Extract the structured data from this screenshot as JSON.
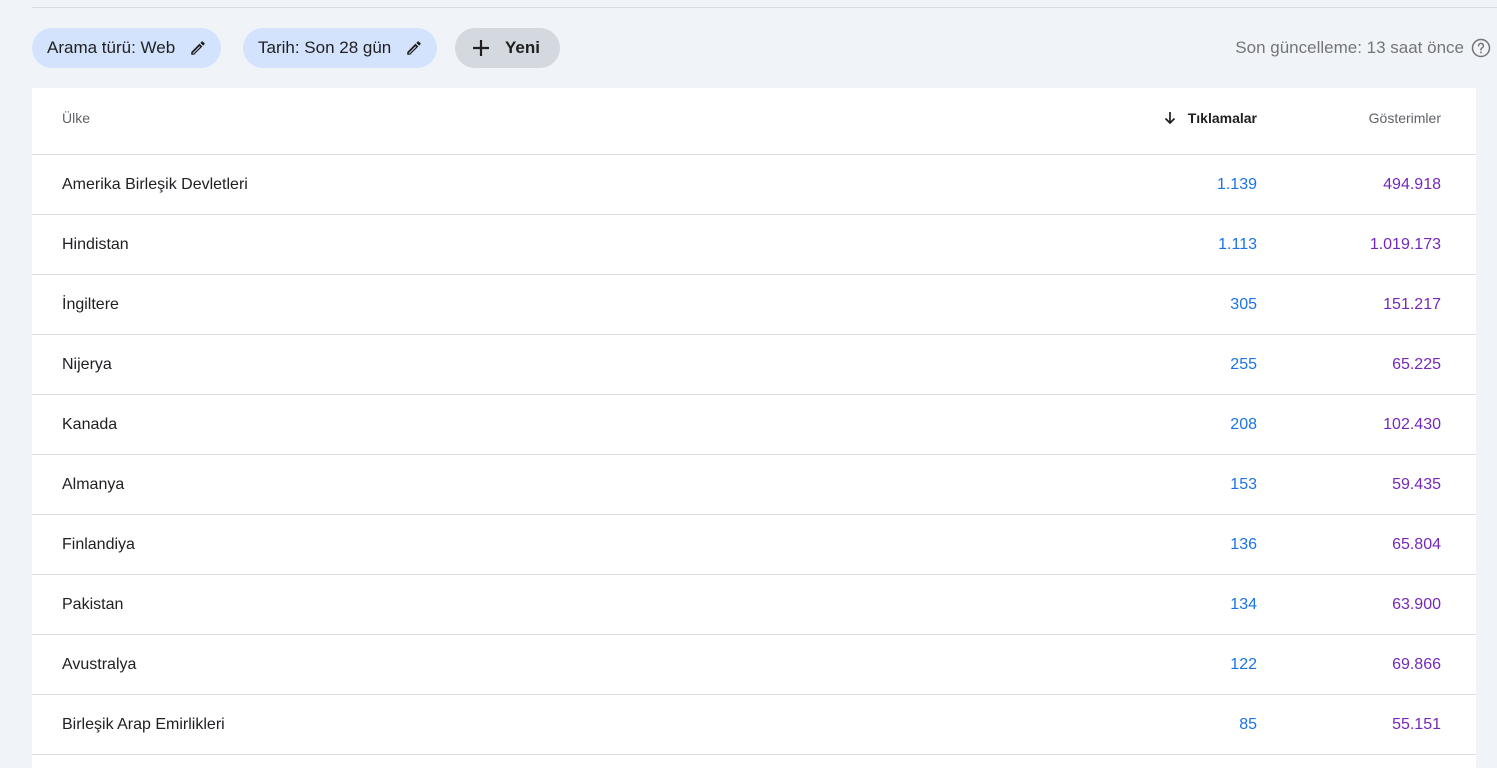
{
  "filters": {
    "search_type": "Arama türü: Web",
    "date": "Tarih: Son 28 gün",
    "new_label": "Yeni"
  },
  "last_update": "Son güncelleme: 13 saat önce",
  "table": {
    "headers": {
      "country": "Ülke",
      "clicks": "Tıklamalar",
      "impressions": "Gösterimler"
    },
    "rows": [
      {
        "country": "Amerika Birleşik Devletleri",
        "clicks": "1.139",
        "impressions": "494.918"
      },
      {
        "country": "Hindistan",
        "clicks": "1.113",
        "impressions": "1.019.173"
      },
      {
        "country": "İngiltere",
        "clicks": "305",
        "impressions": "151.217"
      },
      {
        "country": "Nijerya",
        "clicks": "255",
        "impressions": "65.225"
      },
      {
        "country": "Kanada",
        "clicks": "208",
        "impressions": "102.430"
      },
      {
        "country": "Almanya",
        "clicks": "153",
        "impressions": "59.435"
      },
      {
        "country": "Finlandiya",
        "clicks": "136",
        "impressions": "65.804"
      },
      {
        "country": "Pakistan",
        "clicks": "134",
        "impressions": "63.900"
      },
      {
        "country": "Avustralya",
        "clicks": "122",
        "impressions": "69.866"
      },
      {
        "country": "Birleşik Arap Emirlikleri",
        "clicks": "85",
        "impressions": "55.151"
      }
    ]
  },
  "colors": {
    "clicks": "#1a73e8",
    "impressions": "#7627bb",
    "chip_filter_bg": "#d3e3fd",
    "chip_new_bg": "#d3d9df"
  },
  "icons": {
    "edit": "pencil-icon",
    "add": "plus-icon",
    "help": "help-circle-icon",
    "sort": "arrow-down-icon"
  }
}
